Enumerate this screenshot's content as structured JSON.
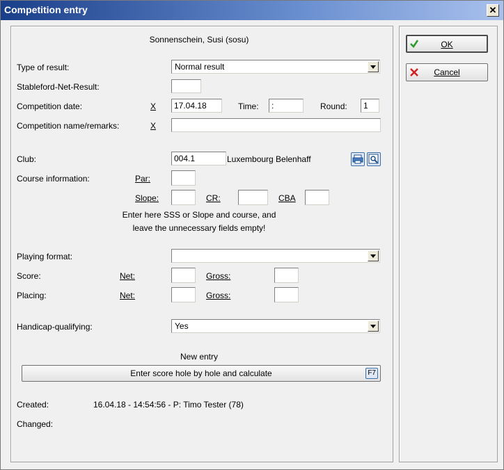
{
  "window": {
    "title": "Competition entry"
  },
  "player": {
    "name": "Sonnenschein, Susi (sosu)"
  },
  "form": {
    "type_of_result": {
      "label": "Type of result:",
      "value": "Normal result"
    },
    "stableford": {
      "label": "Stableford-Net-Result:",
      "value": ""
    },
    "competition_date": {
      "label": "Competition date:",
      "marker": "X",
      "value": "17.04.18"
    },
    "time": {
      "label": "Time:",
      "value": ":"
    },
    "round": {
      "label": "Round:",
      "value": "1"
    },
    "competition_name": {
      "label": "Competition name/remarks:",
      "marker": "X",
      "value": ""
    },
    "club": {
      "label": "Club:",
      "code": "004.1",
      "name": "Luxembourg Belenhaff"
    },
    "course_info": {
      "label": "Course information:",
      "par_label": "Par:",
      "slope_label": "Slope:",
      "cr_label": "CR:",
      "cba_label": "CBA"
    },
    "hint": {
      "line1": "Enter here SSS or Slope and course, and",
      "line2": "leave the unnecessary fields empty!"
    },
    "playing_format": {
      "label": "Playing format:",
      "value": ""
    },
    "score": {
      "label": "Score:",
      "net_label": "Net:",
      "gross_label": "Gross:"
    },
    "placing": {
      "label": "Placing:",
      "net_label": "Net:",
      "gross_label": "Gross:"
    },
    "handicap_qualifying": {
      "label": "Handicap-qualifying:",
      "value": "Yes"
    },
    "new_entry": {
      "label": "New entry"
    },
    "enter_score_button": {
      "label": "Enter score hole by hole and calculate",
      "shortcut": "F7"
    },
    "created": {
      "label": "Created:",
      "value": "16.04.18 - 14:54:56 - P: Timo Tester (78)"
    },
    "changed": {
      "label": "Changed:"
    }
  },
  "actions": {
    "ok_label": "OK",
    "cancel_label": "Cancel"
  }
}
